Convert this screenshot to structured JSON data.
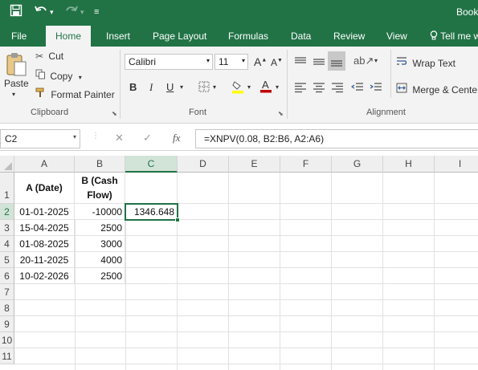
{
  "titlebar": {
    "title": "Book",
    "icons": [
      "save-icon",
      "undo-icon",
      "redo-icon",
      "customize-qat-icon"
    ]
  },
  "tabs": [
    {
      "label": "File"
    },
    {
      "label": "Home"
    },
    {
      "label": "Insert"
    },
    {
      "label": "Page Layout"
    },
    {
      "label": "Formulas"
    },
    {
      "label": "Data"
    },
    {
      "label": "Review"
    },
    {
      "label": "View"
    },
    {
      "label": "Tell me w"
    }
  ],
  "ribbon": {
    "clipboard": {
      "paste": "Paste",
      "cut": "Cut",
      "copy": "Copy",
      "format_painter": "Format Painter",
      "group": "Clipboard"
    },
    "font": {
      "name": "Calibri",
      "size": "11",
      "bold": "B",
      "italic": "I",
      "underline": "U",
      "group": "Font"
    },
    "alignment": {
      "wrap_text": "Wrap Text",
      "merge_center": "Merge & Cente",
      "group": "Alignment"
    }
  },
  "formula_bar": {
    "name_box": "C2",
    "fx": "fx",
    "formula": "=XNPV(0.08, B2:B6, A2:A6)"
  },
  "sheet": {
    "columns": [
      "A",
      "B",
      "C",
      "D",
      "E",
      "F",
      "G",
      "H",
      "I"
    ],
    "rows": [
      "1",
      "2",
      "3",
      "4",
      "5",
      "6",
      "7",
      "8",
      "9",
      "10",
      "11"
    ],
    "header_a": "A (Date)",
    "header_b_line1": "B (Cash",
    "header_b_line2": "Flow)",
    "data": [
      {
        "date": "01-01-2025",
        "flow": "-10000",
        "result": "1346.648"
      },
      {
        "date": "15-04-2025",
        "flow": "2500",
        "result": ""
      },
      {
        "date": "01-08-2025",
        "flow": "3000",
        "result": ""
      },
      {
        "date": "20-11-2025",
        "flow": "4000",
        "result": ""
      },
      {
        "date": "10-02-2026",
        "flow": "2500",
        "result": ""
      }
    ],
    "selected_cell": "C2"
  },
  "colors": {
    "excel_green": "#217346",
    "ribbon_bg": "#f3f3f3",
    "fill_yellow": "#ffff00",
    "font_red": "#c00000"
  }
}
